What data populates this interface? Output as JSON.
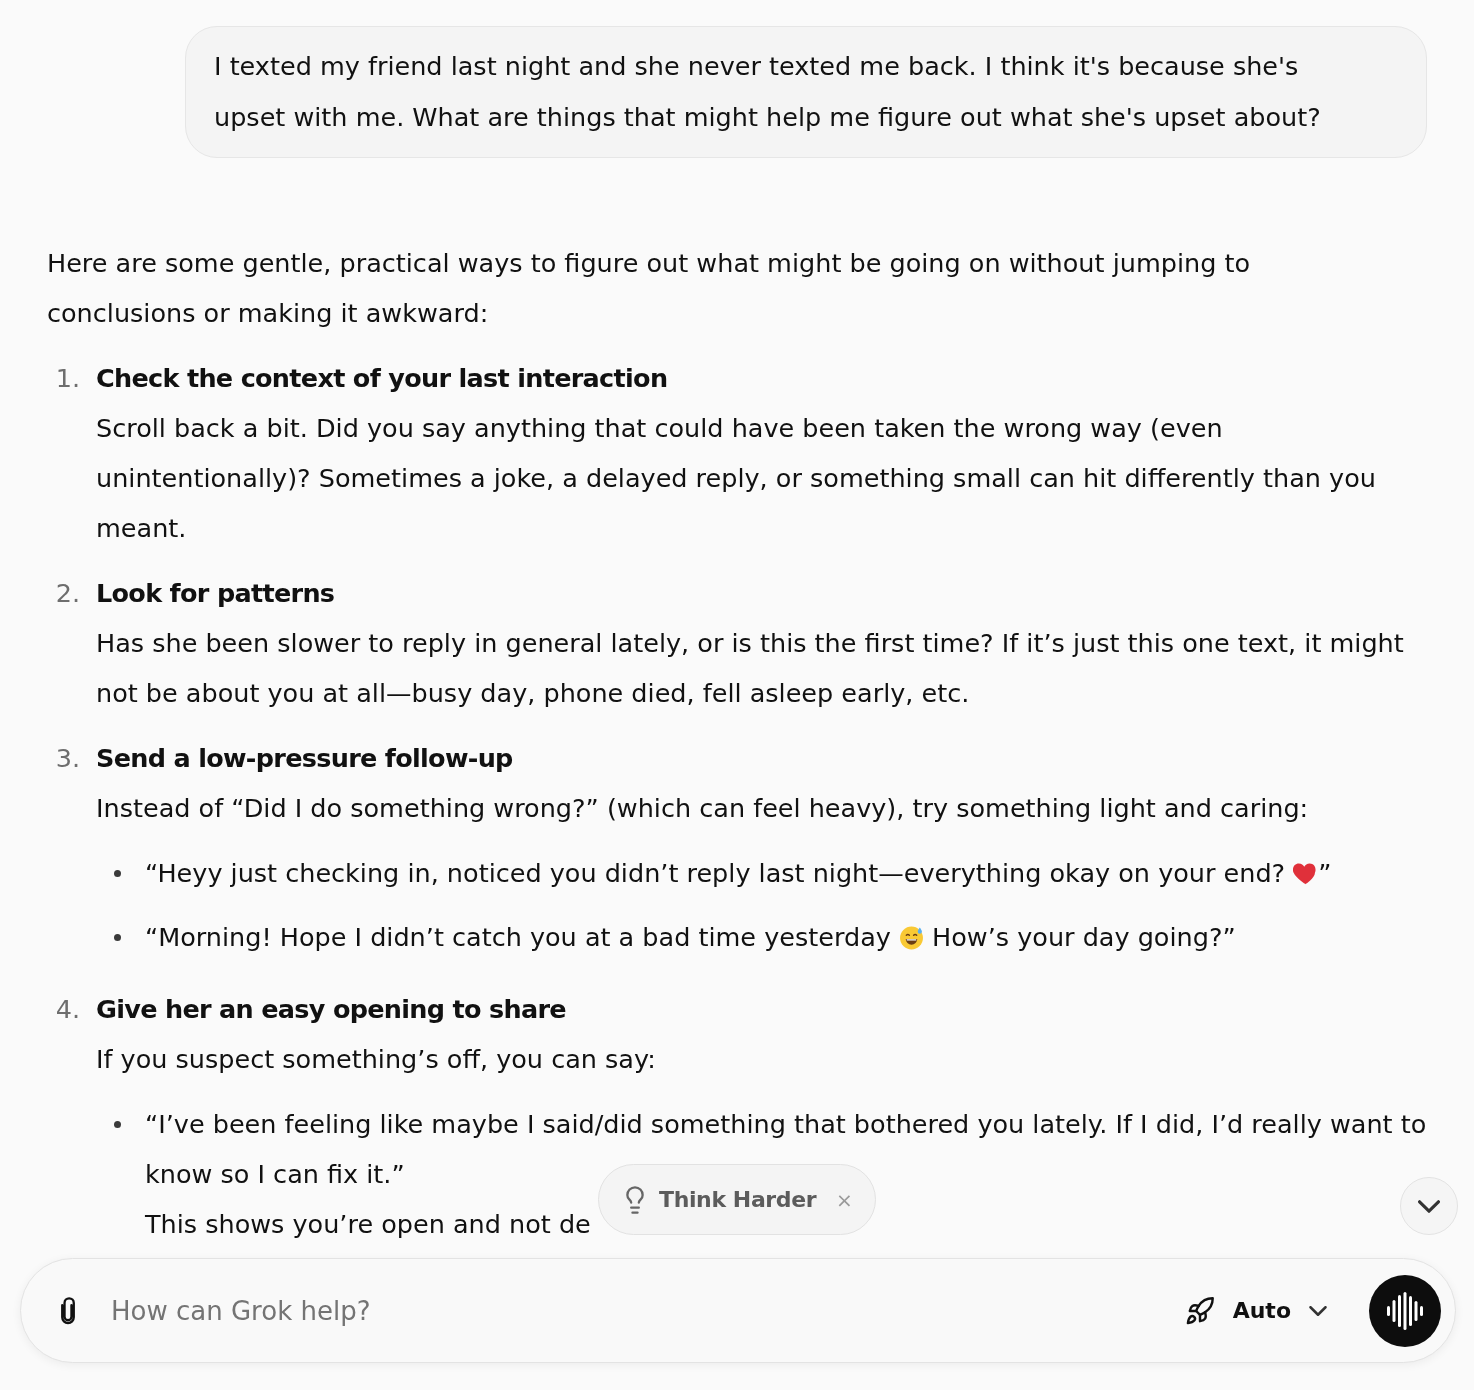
{
  "user_message": {
    "text": "I texted my friend last night and she never texted me back. I think it's because she's upset with me. What are things that might help me figure out what she's upset about?"
  },
  "response": {
    "intro": "Here are some gentle, practical ways to figure out what might be going on without jumping to conclusions or making it awkward:",
    "steps": [
      {
        "number": "1.",
        "title": "Check the context of your last interaction",
        "body": "Scroll back a bit. Did you say anything that could have been taken the wrong way (even unintentionally)? Sometimes a joke, a delayed reply, or something small can hit differently than you meant."
      },
      {
        "number": "2.",
        "title": "Look for patterns",
        "body": "Has she been slower to reply in general lately, or is this the first time? If it’s just this one text, it might not be about you at all—busy day, phone died, fell asleep early, etc."
      },
      {
        "number": "3.",
        "title": "Send a low-pressure follow-up",
        "body": "Instead of “Did I do something wrong?” (which can feel heavy), try something light and caring:",
        "bullets": [
          {
            "segments": [
              {
                "kind": "text",
                "text": "“Heyy just checking in, noticed you didn’t reply last night—everything okay on your end? "
              },
              {
                "kind": "heart"
              },
              {
                "kind": "text",
                "text": "”"
              }
            ]
          },
          {
            "segments": [
              {
                "kind": "text",
                "text": "“Morning! Hope I didn’t catch you at a bad time yesterday "
              },
              {
                "kind": "sweat_smile"
              },
              {
                "kind": "text",
                "text": " How’s your day going?”"
              }
            ]
          }
        ]
      },
      {
        "number": "4.",
        "title": "Give her an easy opening to share",
        "body": "If you suspect something’s off, you can say:",
        "bullets": [
          {
            "segments": [
              {
                "kind": "text",
                "text": "“I’ve been feeling like maybe I said/did something that bothered you lately. If I did, I’d really want to know so I can fix it.”"
              }
            ],
            "note": "This shows you’re open and not de"
          }
        ]
      }
    ]
  },
  "think_harder": {
    "label": "Think Harder",
    "close": "×"
  },
  "composer": {
    "placeholder": "How can Grok help?",
    "mode": "Auto"
  }
}
